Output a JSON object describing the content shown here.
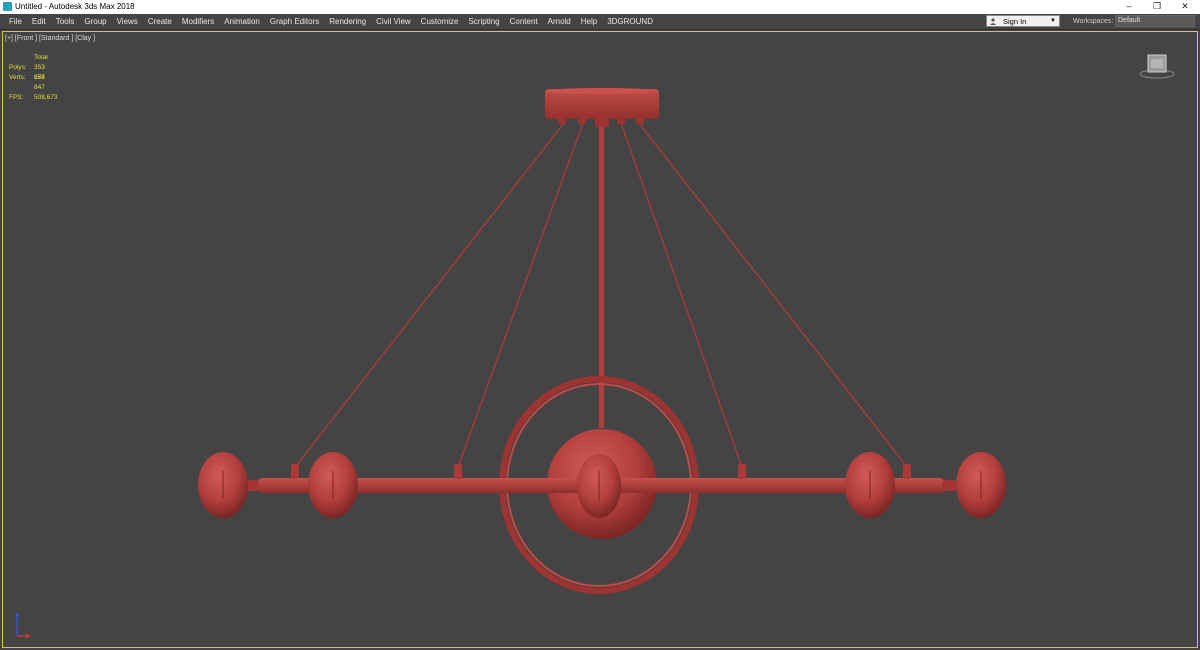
{
  "window": {
    "title": "Untitled - Autodesk 3ds Max 2018"
  },
  "menu": [
    "File",
    "Edit",
    "Tools",
    "Group",
    "Views",
    "Create",
    "Modifiers",
    "Animation",
    "Graph Editors",
    "Rendering",
    "Civil View",
    "Customize",
    "Scripting",
    "Content",
    "Arnold",
    "Help",
    "3DGROUND"
  ],
  "account": {
    "sign_in_label": "Sign In"
  },
  "workspaces": {
    "label": "Workspaces:",
    "value": "Default"
  },
  "viewport": {
    "label": "[+] [Front ] [Standard ] [Clay ]",
    "stats": {
      "header": "Total",
      "polys_label": "Polys:",
      "polys_value": "353 056",
      "verts_label": "Verts:",
      "verts_value": "177 847",
      "fps_label": "FPS:",
      "fps_value": "508,673"
    }
  },
  "colors": {
    "model_clay": "#b5403e",
    "viewport_bg": "#444444",
    "viewport_border": "#d9c64a",
    "stats_text": "#e8df3a"
  },
  "icons": [
    "app-icon",
    "minimize-icon",
    "restore-icon",
    "close-icon",
    "user-icon",
    "dropdown-icon",
    "viewcube-icon",
    "axis-tripod-icon"
  ]
}
